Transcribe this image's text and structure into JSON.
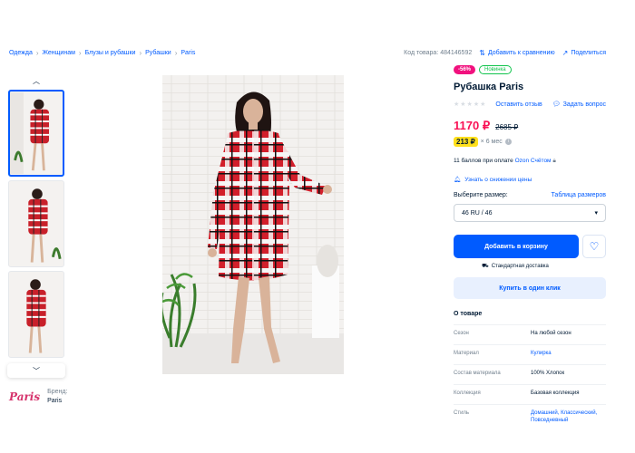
{
  "breadcrumbs": [
    "Одежда",
    "Женщинам",
    "Блузы и рубашки",
    "Рубашки",
    "Paris"
  ],
  "top_actions": {
    "code": "Код товара: 484146592",
    "compare": "Добавить к сравнению",
    "share": "Поделиться"
  },
  "brand": {
    "logo": "Paris",
    "label": "Бренд:",
    "name": "Paris"
  },
  "product": {
    "badge_sale": "-56%",
    "badge_new": "Новинка",
    "title": "Рубашка Paris",
    "stars": "★★★★★",
    "review_link": "Оставить отзыв",
    "ask_link": "Задать вопрос",
    "price": "1170 ₽",
    "old_price": "2685 ₽",
    "installment_amount": "213 ₽",
    "installment_term": "× 6 мес",
    "bonus_prefix": "11 баллов при оплате",
    "bonus_card": "Ozon Счётом",
    "notify_price": "Узнать о снижении цены",
    "size_label": "Выберите размер:",
    "size_table": "Таблица размеров",
    "size_selected": "46 RU / 46",
    "cart_button": "Добавить в корзину",
    "delivery": "Стандартная доставка",
    "buy_one_click": "Купить в один клик"
  },
  "about": {
    "title": "О товаре",
    "specs": [
      {
        "key": "Сезон",
        "value": "На любой сезон"
      },
      {
        "key": "Материал",
        "value": "Кулирка"
      },
      {
        "key": "Состав материала",
        "value": "100% Хлопок"
      },
      {
        "key": "Коллекция",
        "value": "Базовая коллекция"
      },
      {
        "key": "Стиль",
        "value": "Домашний, Классический, Повседневный"
      }
    ]
  },
  "colors": {
    "accent": "#005bff",
    "price": "#f91155",
    "sale": "#f1117e",
    "new": "#10c44c",
    "installment": "#ffe01b"
  }
}
